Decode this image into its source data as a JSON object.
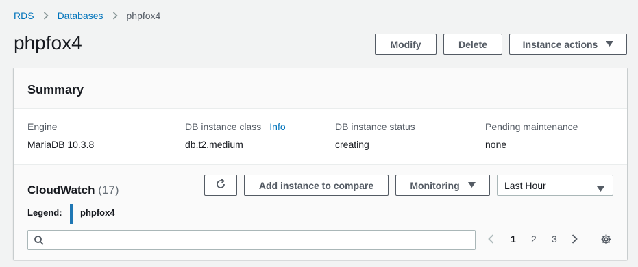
{
  "breadcrumb": {
    "items": [
      "RDS",
      "Databases"
    ],
    "current": "phpfox4"
  },
  "page": {
    "title": "phpfox4"
  },
  "actions": {
    "modify": "Modify",
    "delete": "Delete",
    "instance_actions": "Instance actions"
  },
  "summary": {
    "title": "Summary",
    "columns": [
      {
        "label": "Engine",
        "value": "MariaDB 10.3.8"
      },
      {
        "label": "DB instance class",
        "info": "Info",
        "value": "db.t2.medium"
      },
      {
        "label": "DB instance status",
        "value": "creating"
      },
      {
        "label": "Pending maintenance",
        "value": "none"
      }
    ]
  },
  "cloudwatch": {
    "title": "CloudWatch",
    "count": "(17)",
    "add_compare": "Add instance to compare",
    "monitoring": "Monitoring",
    "time_range": "Last Hour",
    "legend_label": "Legend:",
    "legend_item": "phpfox4",
    "legend_color": "#1f77b4",
    "search_placeholder": "",
    "pages": [
      "1",
      "2",
      "3"
    ],
    "current_page": "1"
  },
  "colors": {
    "link": "#0073bb",
    "background": "#f2f3f3",
    "text": "#16191f"
  }
}
